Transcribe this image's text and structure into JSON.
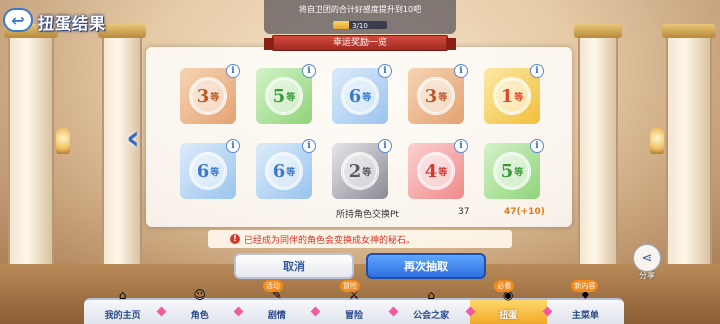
{
  "header": {
    "back_icon": "back-arrow-icon",
    "title": "扭蛋结果"
  },
  "mission": {
    "text": "将自卫团的合计好感度提升到10吧",
    "progress_label": "3/10",
    "progress_fraction": 0.3
  },
  "panel": {
    "title": "幸运奖励一览",
    "rows": [
      [
        {
          "num": "3",
          "unit": "等",
          "color": "bronze"
        },
        {
          "num": "5",
          "unit": "等",
          "color": "green"
        },
        {
          "num": "6",
          "unit": "等",
          "color": "blue"
        },
        {
          "num": "3",
          "unit": "等",
          "color": "bronze"
        },
        {
          "num": "1",
          "unit": "等",
          "color": "gold"
        }
      ],
      [
        {
          "num": "6",
          "unit": "等",
          "color": "blue"
        },
        {
          "num": "6",
          "unit": "等",
          "color": "blue"
        },
        {
          "num": "2",
          "unit": "等",
          "color": "silver"
        },
        {
          "num": "4",
          "unit": "等",
          "color": "red"
        },
        {
          "num": "5",
          "unit": "等",
          "color": "green"
        }
      ]
    ],
    "info_label": "i",
    "pt_label": "所持角色交换Pt",
    "pt_current": "37",
    "pt_new": "47(+10)"
  },
  "notice": {
    "icon": "!",
    "text": "已经成为同伴的角色会变换成女神的秘石。"
  },
  "buttons": {
    "cancel": "取消",
    "again": "再次抽取"
  },
  "share": {
    "icon": "share-icon",
    "label": "分享"
  },
  "nav": {
    "items": [
      {
        "label": "我的主页",
        "icon": "home-icon",
        "glyph": "⌂"
      },
      {
        "label": "角色",
        "icon": "character-icon",
        "glyph": "☺"
      },
      {
        "label": "剧情",
        "icon": "story-icon",
        "glyph": "✎",
        "badge": "活动"
      },
      {
        "label": "冒险",
        "icon": "adventure-icon",
        "glyph": "⚔",
        "badge": "冒险"
      },
      {
        "label": "公会之家",
        "icon": "guild-house-icon",
        "glyph": "⌂"
      },
      {
        "label": "扭蛋",
        "icon": "gacha-icon",
        "glyph": "◉",
        "badge": "必看",
        "active": true
      },
      {
        "label": "主菜单",
        "icon": "main-menu-icon",
        "glyph": "♦",
        "badge": "新内容"
      }
    ]
  }
}
